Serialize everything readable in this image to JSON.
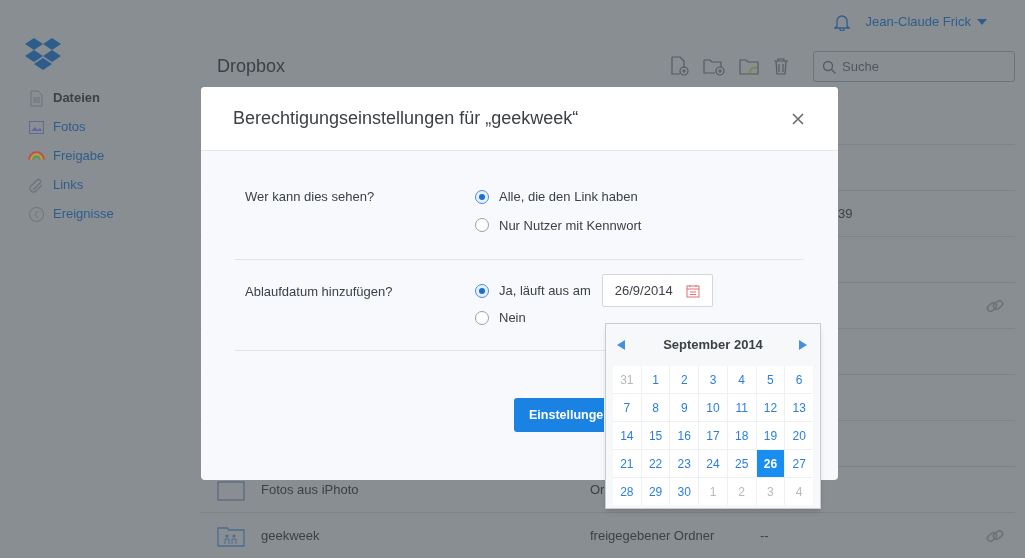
{
  "header": {
    "user": "Jean-Claude Frick",
    "title": "Dropbox",
    "search": {
      "placeholder": "Suche"
    }
  },
  "sidebar": {
    "items": [
      {
        "label": "Dateien",
        "selected": true
      },
      {
        "label": "Fotos",
        "selected": false
      },
      {
        "label": "Freigabe",
        "selected": false
      },
      {
        "label": "Links",
        "selected": false
      },
      {
        "label": "Ereignisse",
        "selected": false
      }
    ]
  },
  "files": {
    "rows": [
      {
        "link": false
      },
      {
        "column_4": "39",
        "link": false
      },
      {
        "link": false
      },
      {
        "link": true
      },
      {
        "link": false
      },
      {
        "link": false
      },
      {
        "link": false
      },
      {
        "kind": "folder",
        "name": "Fotos aus iPhoto",
        "type": "Or",
        "link": false
      },
      {
        "kind": "shared_folder",
        "name": "geekweek",
        "type": "freigegebener Ordner",
        "modified": "--",
        "link": true
      }
    ]
  },
  "dialog": {
    "title": "Berechtigungseinstellungen für „geekweek“",
    "sections": [
      {
        "label": "Wer kann dies sehen?",
        "options": [
          {
            "label": "Alle, die den Link haben",
            "selected": true
          },
          {
            "label": "Nur Nutzer mit Kennwort",
            "selected": false
          }
        ]
      },
      {
        "label": "Ablaufdatum hinzufügen?",
        "options": [
          {
            "label": "Ja, läuft aus am",
            "selected": true,
            "date": "26/9/2014"
          },
          {
            "label": "Nein",
            "selected": false
          }
        ]
      }
    ],
    "button": "Einstellunge"
  },
  "calendar": {
    "month": "September 2014",
    "days": [
      {
        "label": "31",
        "in_month": false,
        "selected": false
      },
      {
        "label": "1",
        "in_month": true,
        "selected": false
      },
      {
        "label": "2",
        "in_month": true,
        "selected": false
      },
      {
        "label": "3",
        "in_month": true,
        "selected": false
      },
      {
        "label": "4",
        "in_month": true,
        "selected": false
      },
      {
        "label": "5",
        "in_month": true,
        "selected": false
      },
      {
        "label": "6",
        "in_month": true,
        "selected": false
      },
      {
        "label": "7",
        "in_month": true,
        "selected": false
      },
      {
        "label": "8",
        "in_month": true,
        "selected": false
      },
      {
        "label": "9",
        "in_month": true,
        "selected": false
      },
      {
        "label": "10",
        "in_month": true,
        "selected": false
      },
      {
        "label": "11",
        "in_month": true,
        "selected": false
      },
      {
        "label": "12",
        "in_month": true,
        "selected": false
      },
      {
        "label": "13",
        "in_month": true,
        "selected": false
      },
      {
        "label": "14",
        "in_month": true,
        "selected": false
      },
      {
        "label": "15",
        "in_month": true,
        "selected": false
      },
      {
        "label": "16",
        "in_month": true,
        "selected": false
      },
      {
        "label": "17",
        "in_month": true,
        "selected": false
      },
      {
        "label": "18",
        "in_month": true,
        "selected": false
      },
      {
        "label": "19",
        "in_month": true,
        "selected": false
      },
      {
        "label": "20",
        "in_month": true,
        "selected": false
      },
      {
        "label": "21",
        "in_month": true,
        "selected": false
      },
      {
        "label": "22",
        "in_month": true,
        "selected": false
      },
      {
        "label": "23",
        "in_month": true,
        "selected": false
      },
      {
        "label": "24",
        "in_month": true,
        "selected": false
      },
      {
        "label": "25",
        "in_month": true,
        "selected": false
      },
      {
        "label": "26",
        "in_month": true,
        "selected": true
      },
      {
        "label": "27",
        "in_month": true,
        "selected": false
      },
      {
        "label": "28",
        "in_month": true,
        "selected": false
      },
      {
        "label": "29",
        "in_month": true,
        "selected": false
      },
      {
        "label": "30",
        "in_month": true,
        "selected": false
      },
      {
        "label": "1",
        "in_month": false,
        "selected": false
      },
      {
        "label": "2",
        "in_month": false,
        "selected": false
      },
      {
        "label": "3",
        "in_month": false,
        "selected": false
      },
      {
        "label": "4",
        "in_month": false,
        "selected": false
      }
    ]
  }
}
